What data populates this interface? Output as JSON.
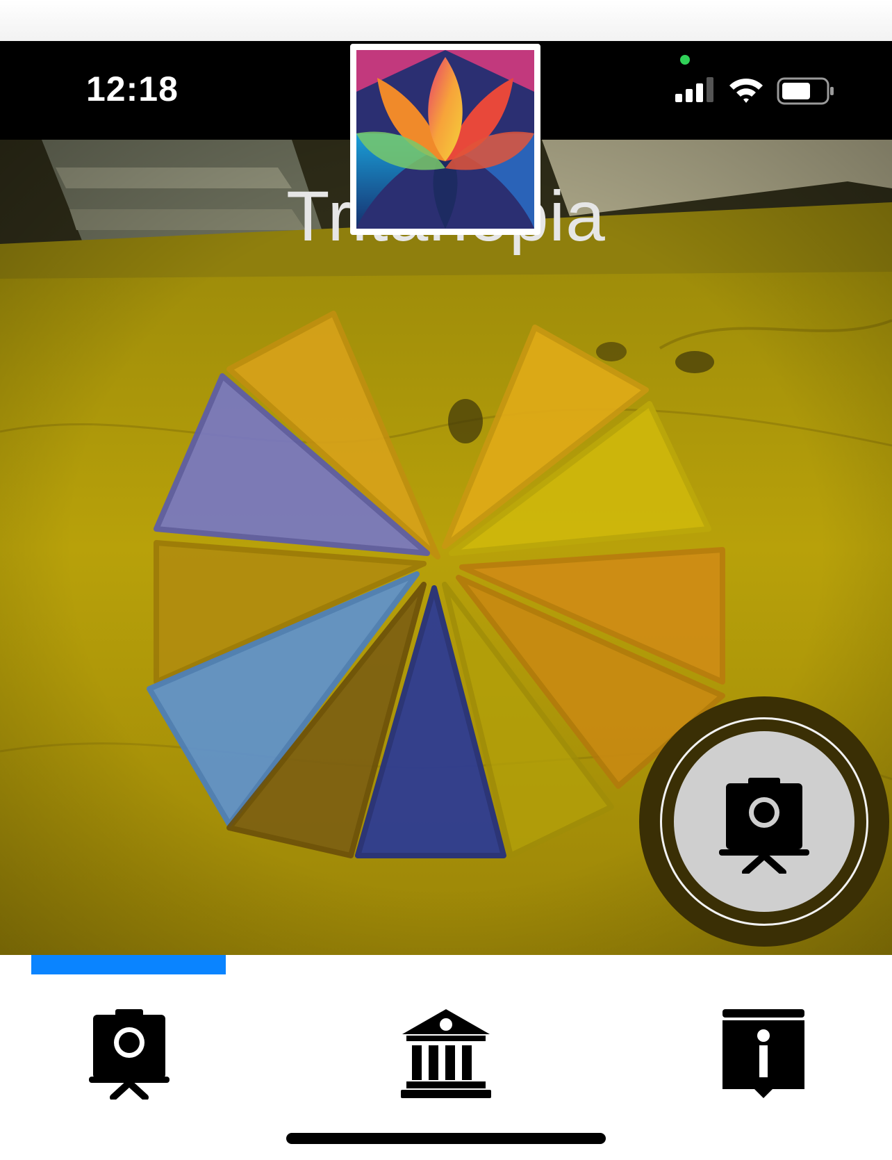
{
  "status_bar": {
    "time": "12:18",
    "icons": [
      "privacy-dot",
      "cellular-signal-icon",
      "wifi-icon",
      "battery-icon"
    ]
  },
  "camera": {
    "filter_mode": "Tritanopia",
    "capture_button_icon": "camera-on-tripod-icon"
  },
  "tab_bar": {
    "tabs": [
      {
        "icon": "camera-on-tripod-icon",
        "selected": true
      },
      {
        "icon": "museum-icon",
        "selected": false
      },
      {
        "icon": "info-icon",
        "selected": false
      }
    ]
  },
  "colors": {
    "accent": "#0a84ff",
    "tint": "#c4b20a"
  }
}
